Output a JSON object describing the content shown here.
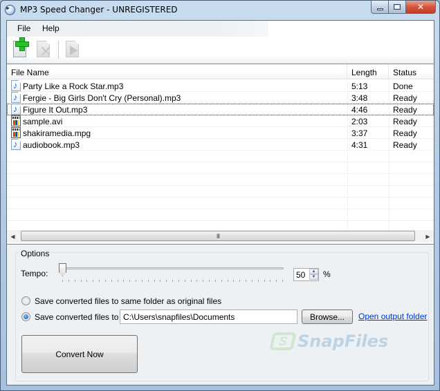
{
  "window": {
    "title": "MP3 Speed Changer - UNREGISTERED",
    "controls": {
      "minimize": "minimize",
      "maximize": "maximize",
      "close": "✕"
    }
  },
  "menu": [
    "File",
    "Help"
  ],
  "toolbar": {
    "buttons": [
      {
        "name": "add-file",
        "icon": "add-document-icon",
        "enabled": true
      },
      {
        "name": "remove-file",
        "icon": "remove-document-icon",
        "enabled": false
      },
      {
        "name": "play",
        "icon": "play-icon",
        "enabled": false
      }
    ]
  },
  "file_list": {
    "columns": [
      "File Name",
      "Length",
      "Status"
    ],
    "rows": [
      {
        "name": "Party Like a Rock Star.mp3",
        "length": "5:13",
        "status": "Done",
        "type": "audio"
      },
      {
        "name": "Fergie - Big Girls Don't Cry (Personal).mp3",
        "length": "3:48",
        "status": "Ready",
        "type": "audio"
      },
      {
        "name": "Figure It Out.mp3",
        "length": "4:46",
        "status": "Ready",
        "type": "audio",
        "focused": true
      },
      {
        "name": "sample.avi",
        "length": "2:03",
        "status": "Ready",
        "type": "video"
      },
      {
        "name": "shakiramedia.mpg",
        "length": "3:37",
        "status": "Ready",
        "type": "video"
      },
      {
        "name": "audiobook.mp3",
        "length": "4:31",
        "status": "Ready",
        "type": "audio"
      }
    ],
    "scroll_thumb_glyph": "III"
  },
  "options": {
    "legend": "Options",
    "tempo_label": "Tempo:",
    "tempo_slider_position": 0,
    "tempo_value": "50",
    "tempo_unit": "%",
    "radio_same_folder": "Save converted files to same folder as original files",
    "radio_custom_folder": "Save converted files to",
    "selected_output": "custom",
    "output_path": "C:\\Users\\snapfiles\\Documents",
    "browse_label": "Browse...",
    "open_folder_link": "Open output folder",
    "convert_label": "Convert Now"
  },
  "watermark": {
    "text": "SnapFiles",
    "logo": "S"
  }
}
